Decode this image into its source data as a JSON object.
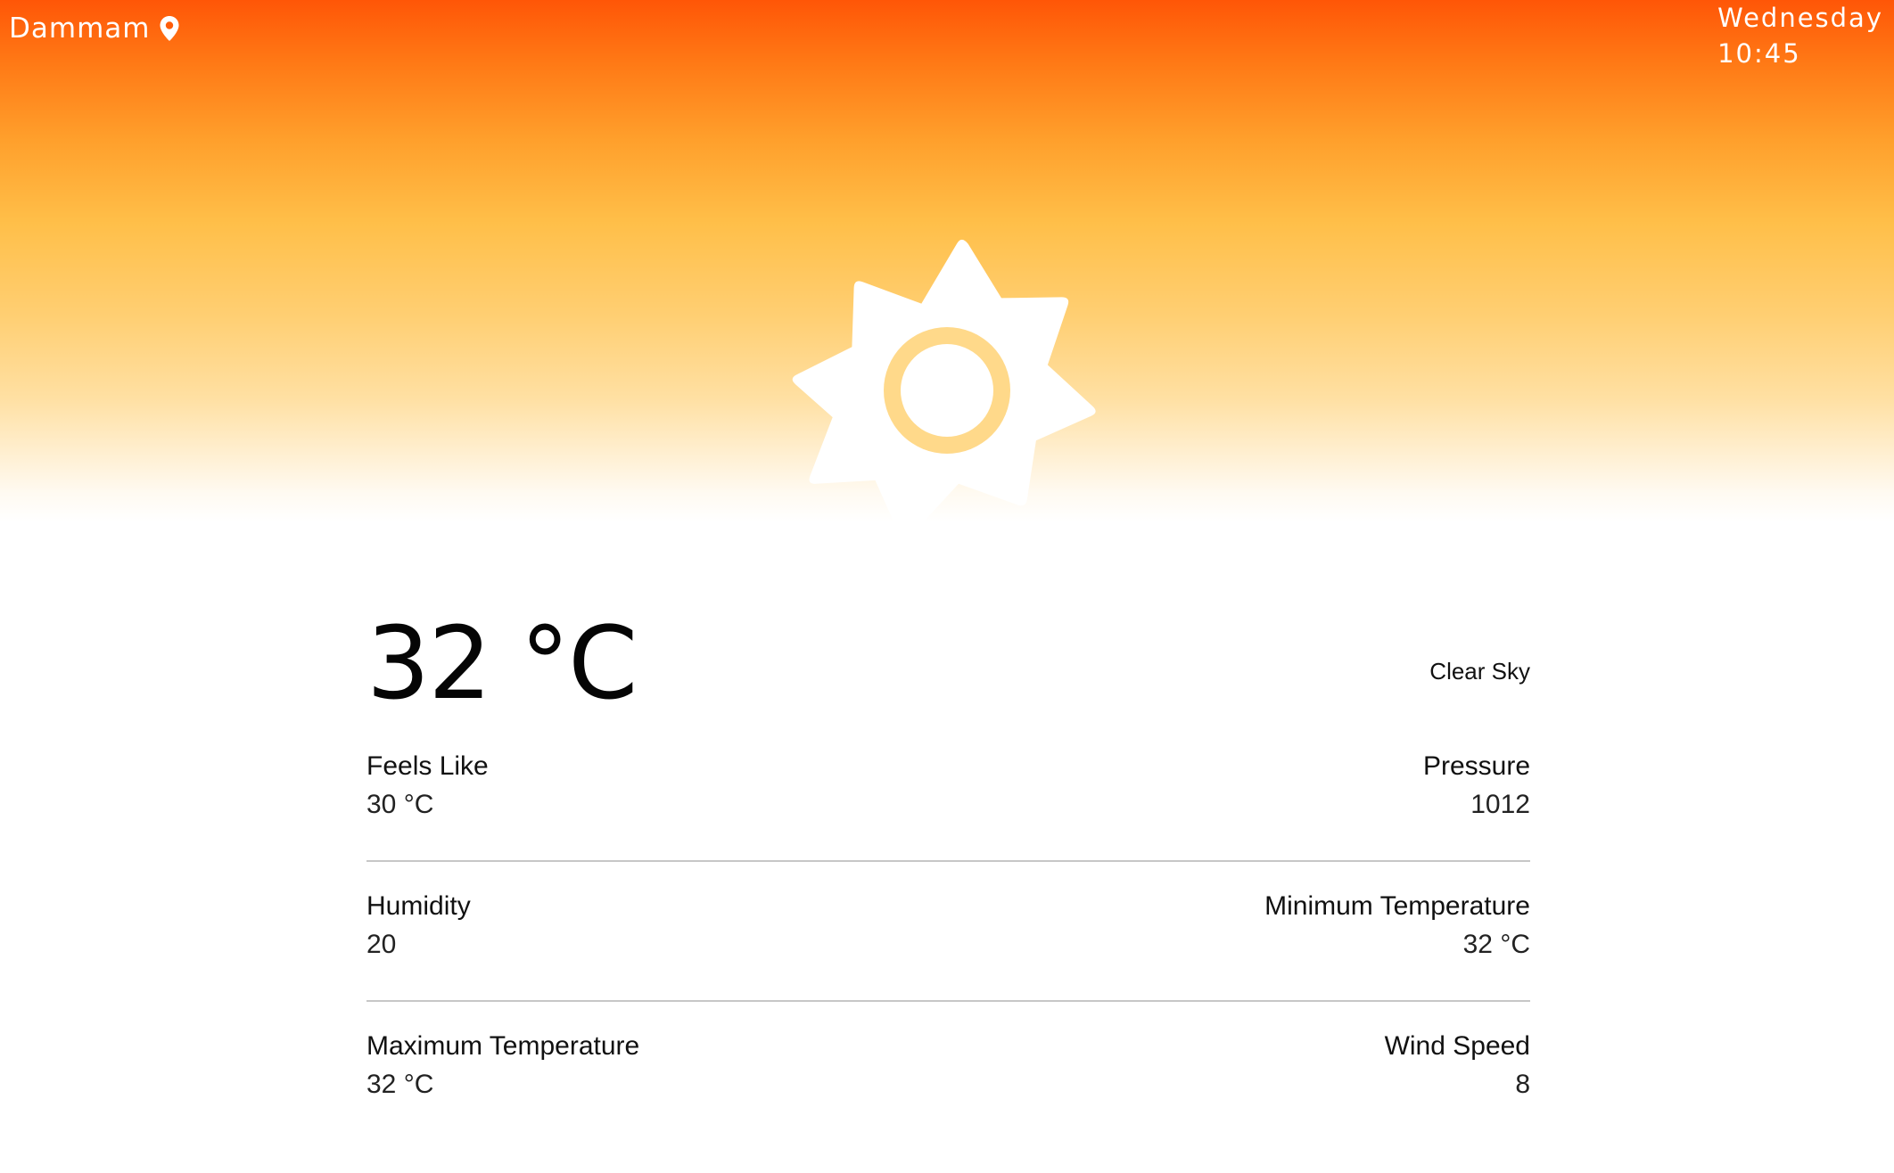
{
  "header": {
    "city": "Dammam",
    "day": "Wednesday",
    "time": "10:45"
  },
  "weather": {
    "icon": "sun-icon",
    "temperature": "32 °C",
    "condition": "Clear Sky"
  },
  "stats": {
    "feels_like": {
      "label": "Feels Like",
      "value": "30 °C"
    },
    "pressure": {
      "label": "Pressure",
      "value": "1012"
    },
    "humidity": {
      "label": "Humidity",
      "value": "20"
    },
    "min_temp": {
      "label": "Minimum Temperature",
      "value": "32 °C"
    },
    "max_temp": {
      "label": "Maximum Temperature",
      "value": "32 °C"
    },
    "wind_speed": {
      "label": "Wind Speed",
      "value": "8"
    }
  },
  "colors": {
    "gradient_top": "#ff5607",
    "gradient_mid": "#ffbf49",
    "sun_ring": "#ffd98a",
    "text_white": "#ffffff",
    "divider": "#c7c7c7"
  }
}
